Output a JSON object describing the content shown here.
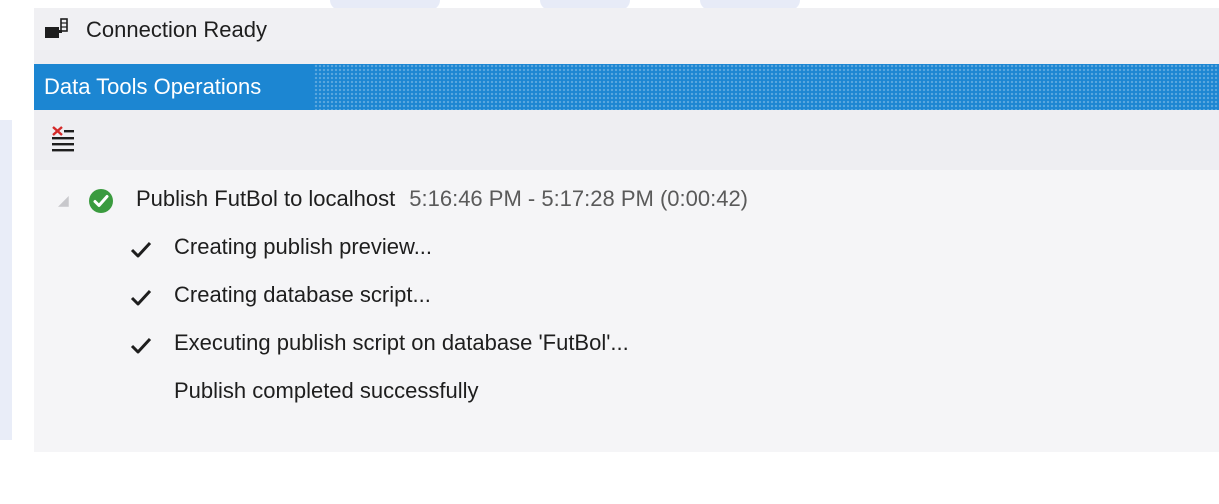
{
  "status": {
    "icon": "connection-icon",
    "text": "Connection Ready"
  },
  "panel": {
    "title": "Data Tools Operations",
    "toolbar": {
      "clear_icon": "clear-list-icon"
    }
  },
  "operation": {
    "icon": "success-check-circle-icon",
    "title": "Publish FutBol to localhost",
    "time_range": "5:16:46 PM - 5:17:28 PM (0:00:42)",
    "steps": [
      {
        "icon": "checkmark-icon",
        "text": "Creating publish preview..."
      },
      {
        "icon": "checkmark-icon",
        "text": "Creating database script..."
      },
      {
        "icon": "checkmark-icon",
        "text": "Executing publish script on database 'FutBol'..."
      }
    ],
    "result": "Publish completed successfully"
  },
  "colors": {
    "title_bar": "#1c86d2",
    "success": "#3a9b3f",
    "clear_icon_red": "#d42a2a"
  }
}
